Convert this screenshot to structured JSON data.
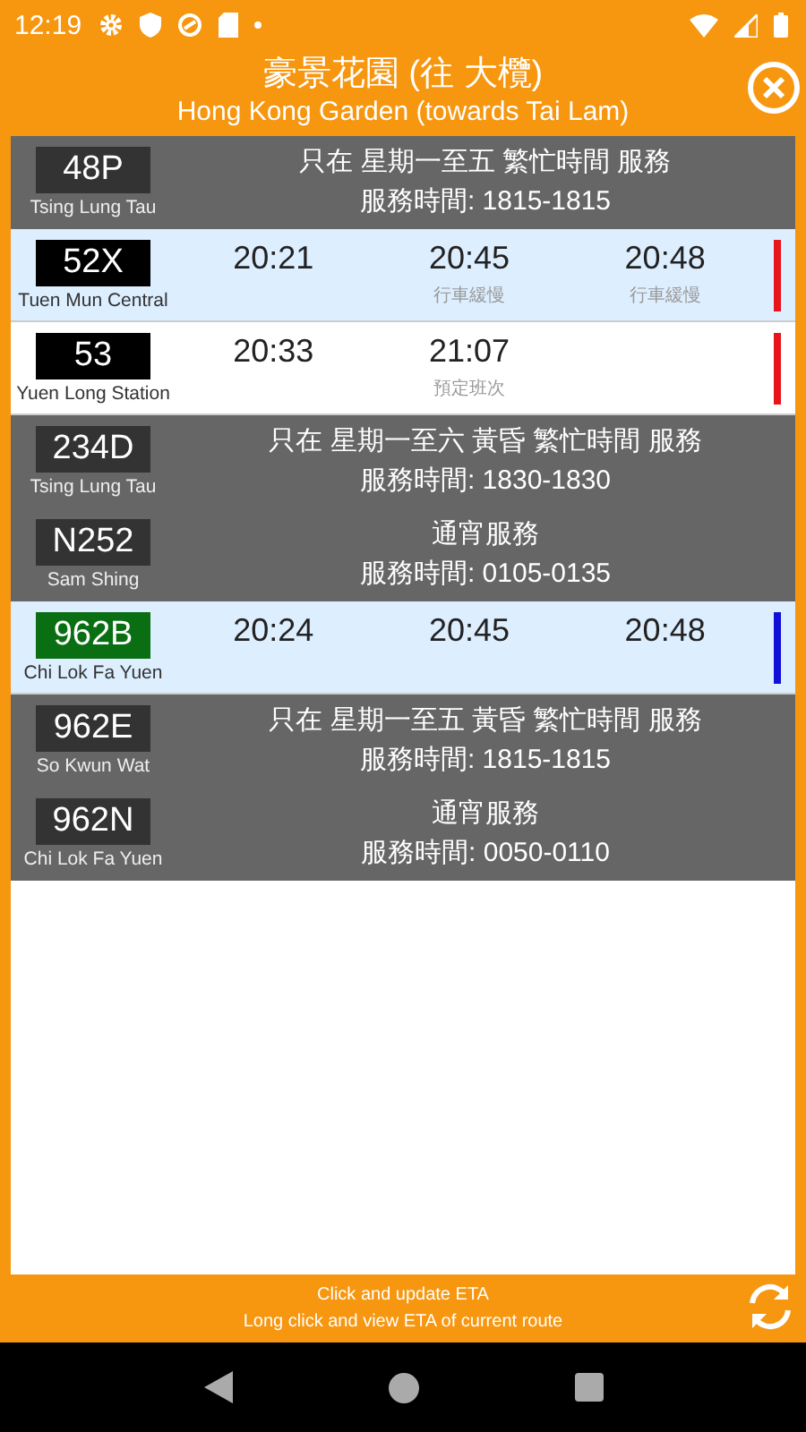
{
  "status_bar": {
    "time": "12:19"
  },
  "header": {
    "title": "豪景花園 (往 大欖)",
    "subtitle": "Hong Kong Garden (towards Tai Lam)"
  },
  "routes": [
    {
      "kind": "notice",
      "badge": {
        "route": "48P",
        "color": "#333333"
      },
      "destination": "Tsing Lung Tau",
      "lines": [
        "只在 星期一至五 繁忙時間 服務",
        "服務時間:  1815-1815"
      ]
    },
    {
      "kind": "eta",
      "badge": {
        "route": "52X",
        "color": "#000000"
      },
      "destination": "Tuen Mun Central",
      "highlighted": true,
      "bar": {
        "color": "#e8141c"
      },
      "etas": [
        {
          "time": "20:21"
        },
        {
          "time": "20:45",
          "note": "行車緩慢"
        },
        {
          "time": "20:48",
          "note": "行車緩慢"
        }
      ]
    },
    {
      "kind": "eta",
      "badge": {
        "route": "53",
        "color": "#000000"
      },
      "destination": "Yuen Long Station",
      "highlighted": false,
      "bar": {
        "color": "#e8141c"
      },
      "etas": [
        {
          "time": "20:33"
        },
        {
          "time": "21:07",
          "note": "預定班次"
        }
      ]
    },
    {
      "kind": "notice",
      "badge": {
        "route": "234D",
        "color": "#333333"
      },
      "destination": "Tsing Lung Tau",
      "lines": [
        "只在 星期一至六 黃昏 繁忙時間 服務",
        "服務時間:  1830-1830"
      ]
    },
    {
      "kind": "notice",
      "badge": {
        "route": "N252",
        "color": "#333333"
      },
      "destination": "Sam Shing",
      "lines": [
        "通宵服務",
        "服務時間:  0105-0135"
      ]
    },
    {
      "kind": "eta",
      "badge": {
        "route": "962B",
        "color": "#0a6e12"
      },
      "destination": "Chi Lok Fa Yuen",
      "highlighted": true,
      "bar": {
        "color": "#1010d8"
      },
      "etas": [
        {
          "time": "20:24"
        },
        {
          "time": "20:45"
        },
        {
          "time": "20:48"
        }
      ]
    },
    {
      "kind": "notice",
      "badge": {
        "route": "962E",
        "color": "#333333"
      },
      "destination": "So Kwun Wat",
      "lines": [
        "只在 星期一至五 黃昏 繁忙時間 服務",
        "服務時間:  1815-1815"
      ]
    },
    {
      "kind": "notice",
      "badge": {
        "route": "962N",
        "color": "#333333"
      },
      "destination": "Chi Lok Fa Yuen",
      "lines": [
        "通宵服務",
        "服務時間:  0050-0110"
      ]
    }
  ],
  "footer": {
    "lines": [
      "Click and update ETA",
      "Long click and view ETA of current route"
    ]
  }
}
